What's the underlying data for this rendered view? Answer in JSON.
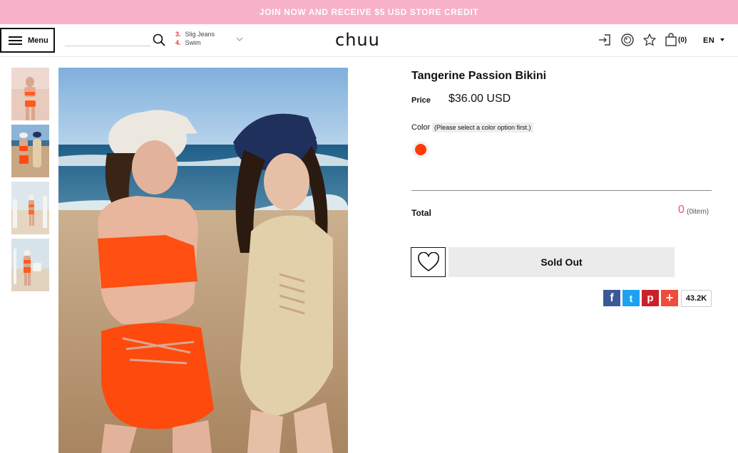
{
  "promo": {
    "text": "JOIN NOW AND RECEIVE $5 USD STORE CREDIT"
  },
  "header": {
    "menu_label": "Menu",
    "search_placeholder": "",
    "suggestions": [
      {
        "rank": "3.",
        "label": "Slig Jeans"
      },
      {
        "rank": "4.",
        "label": "Swim"
      }
    ],
    "logo": "chuu",
    "cart_count": "(0)",
    "language": "EN",
    "icons": [
      "login-icon",
      "globe-icon",
      "star-icon",
      "bag-icon"
    ]
  },
  "gallery": {
    "thumbnails": [
      "thumb-1",
      "thumb-2",
      "thumb-3",
      "thumb-4"
    ]
  },
  "product": {
    "title": "Tangerine Passion Bikini",
    "price_label": "Price",
    "price": "$36.00 USD",
    "color_label": "Color",
    "color_hint": "(Please select a color option first.)",
    "swatch_color": "#ff3b0b",
    "total_label": "Total",
    "total_value": "0",
    "total_items": "(0item)",
    "soldout_label": "Sold Out"
  },
  "share": {
    "facebook": "f",
    "twitter": "t",
    "pinterest": "p",
    "more": "+",
    "count": "43.2K"
  },
  "colors": {
    "promo_bg": "#f7b1c9",
    "accent_pink": "#ee4f7d",
    "facebook": "#3b5998",
    "twitter": "#1da1f2",
    "pinterest": "#cb2027",
    "more": "#f04b3c"
  }
}
